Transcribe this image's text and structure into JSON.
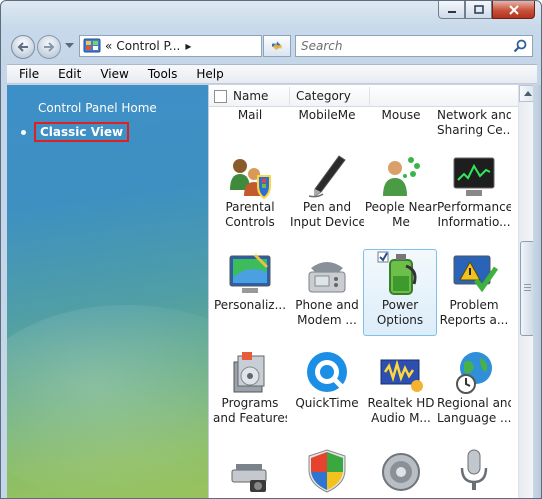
{
  "window": {
    "caption_buttons": [
      "minimize-icon",
      "maximize-icon",
      "close-icon"
    ]
  },
  "address_bar": {
    "prefix": "«",
    "path": "Control P...",
    "separator": "▸",
    "icon": "control-panel-icon"
  },
  "search": {
    "placeholder": "Search"
  },
  "menu": {
    "items": [
      "File",
      "Edit",
      "View",
      "Tools",
      "Help"
    ]
  },
  "left_pane": {
    "home_link": "Control Panel Home",
    "classic_view": "Classic View"
  },
  "columns": {
    "name": "Name",
    "category": "Category"
  },
  "items": [
    {
      "line1": "Mail",
      "line2": "",
      "icon": "mail-icon"
    },
    {
      "line1": "MobileMe",
      "line2": "",
      "icon": "mobileme-icon"
    },
    {
      "line1": "Mouse",
      "line2": "",
      "icon": "mouse-icon"
    },
    {
      "line1": "Network and",
      "line2": "Sharing Ce...",
      "icon": "network-icon"
    },
    {
      "line1": "Parental",
      "line2": "Controls",
      "icon": "parental-controls-icon"
    },
    {
      "line1": "Pen and",
      "line2": "Input Devices",
      "icon": "pen-icon"
    },
    {
      "line1": "People Near",
      "line2": "Me",
      "icon": "people-near-me-icon"
    },
    {
      "line1": "Performance",
      "line2": "Informatio...",
      "icon": "performance-icon"
    },
    {
      "line1": "Personaliz...",
      "line2": "",
      "icon": "personalization-icon"
    },
    {
      "line1": "Phone and",
      "line2": "Modem ...",
      "icon": "phone-modem-icon"
    },
    {
      "line1": "Power",
      "line2": "Options",
      "icon": "power-options-icon"
    },
    {
      "line1": "Problem",
      "line2": "Reports a...",
      "icon": "problem-reports-icon"
    },
    {
      "line1": "Programs",
      "line2": "and Features",
      "icon": "programs-features-icon"
    },
    {
      "line1": "QuickTime",
      "line2": "",
      "icon": "quicktime-icon"
    },
    {
      "line1": "Realtek HD",
      "line2": "Audio M...",
      "icon": "realtek-audio-icon"
    },
    {
      "line1": "Regional and",
      "line2": "Language ...",
      "icon": "regional-language-icon"
    },
    {
      "line1": "",
      "line2": "",
      "icon": "scanners-cameras-icon"
    },
    {
      "line1": "",
      "line2": "",
      "icon": "security-center-icon"
    },
    {
      "line1": "",
      "line2": "",
      "icon": "sound-icon"
    },
    {
      "line1": "",
      "line2": "",
      "icon": "speech-recognition-icon"
    }
  ],
  "selected_item": "Power Options",
  "colors": {
    "highlight_border": "#e02020",
    "selection": "#7ec1ea"
  }
}
